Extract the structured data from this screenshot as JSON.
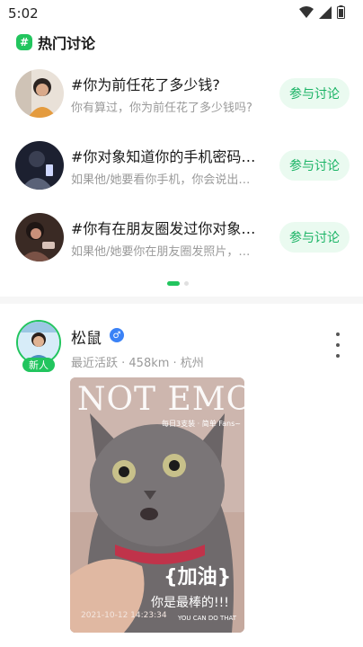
{
  "status_bar": {
    "time": "5:02"
  },
  "section": {
    "badge": "#",
    "title": "热门讨论"
  },
  "topics": [
    {
      "title": "#你为前任花了多少钱?",
      "subtitle": "你有算过，你为前任花了多少钱吗?",
      "button": "参与讨论"
    },
    {
      "title": "#你对象知道你的手机密码…",
      "subtitle": "如果他/她要看你手机，你会说出…",
      "button": "参与讨论"
    },
    {
      "title": "#你有在朋友圈发过你对象…",
      "subtitle": "如果他/她要你在朋友圈发照片，…",
      "button": "参与讨论"
    }
  ],
  "post": {
    "name": "松鼠",
    "badge": "新人",
    "gender_icon": "male-icon",
    "meta": "最近活跃 · 458km · 杭州",
    "image": {
      "headline": "NOT EMO",
      "small_text": "每日3支装 · 简单 Fans~",
      "cheer": "{加油}",
      "slogan": "你是最棒的!!!",
      "date": "2021-10-12  14:23:34",
      "caption": "YOU CAN DO THAT"
    }
  },
  "colors": {
    "accent": "#22c55e",
    "button_bg": "#eafaf0",
    "button_text": "#19b364",
    "muted": "#9a9a9a"
  }
}
